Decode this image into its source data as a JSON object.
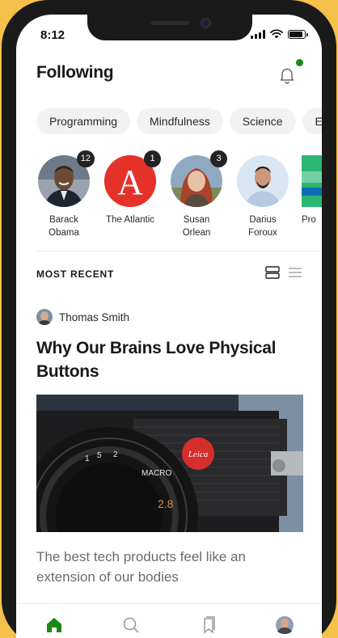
{
  "status_bar": {
    "time": "8:12",
    "battery_level": 0.9
  },
  "header": {
    "title": "Following",
    "notification_icon": "bell-icon",
    "has_unread": true,
    "accent_color": "#1a8917"
  },
  "topics": [
    "Programming",
    "Mindfulness",
    "Science",
    "Equ"
  ],
  "authors": [
    {
      "name_line1": "Barack",
      "name_line2": "Obama",
      "badge": "12"
    },
    {
      "name_line1": "The Atlantic",
      "name_line2": "",
      "badge": "1"
    },
    {
      "name_line1": "Susan",
      "name_line2": "Orlean",
      "badge": "3"
    },
    {
      "name_line1": "Darius",
      "name_line2": "Foroux",
      "badge": ""
    },
    {
      "name_line1": "Pro",
      "name_line2": "",
      "badge": ""
    }
  ],
  "feed": {
    "section_label": "MOST RECENT",
    "view_modes": [
      "card-view-icon",
      "list-view-icon"
    ],
    "article": {
      "author": "Thomas Smith",
      "title": "Why Our Brains Love Physical Buttons",
      "subtitle": "The best tech products feel like an extension of our bodies",
      "image": "leica-camera-lens-photo"
    }
  },
  "tabbar": {
    "tabs": [
      "home-icon",
      "search-icon",
      "bookmarks-icon",
      "profile-avatar"
    ],
    "active": "home-icon"
  }
}
